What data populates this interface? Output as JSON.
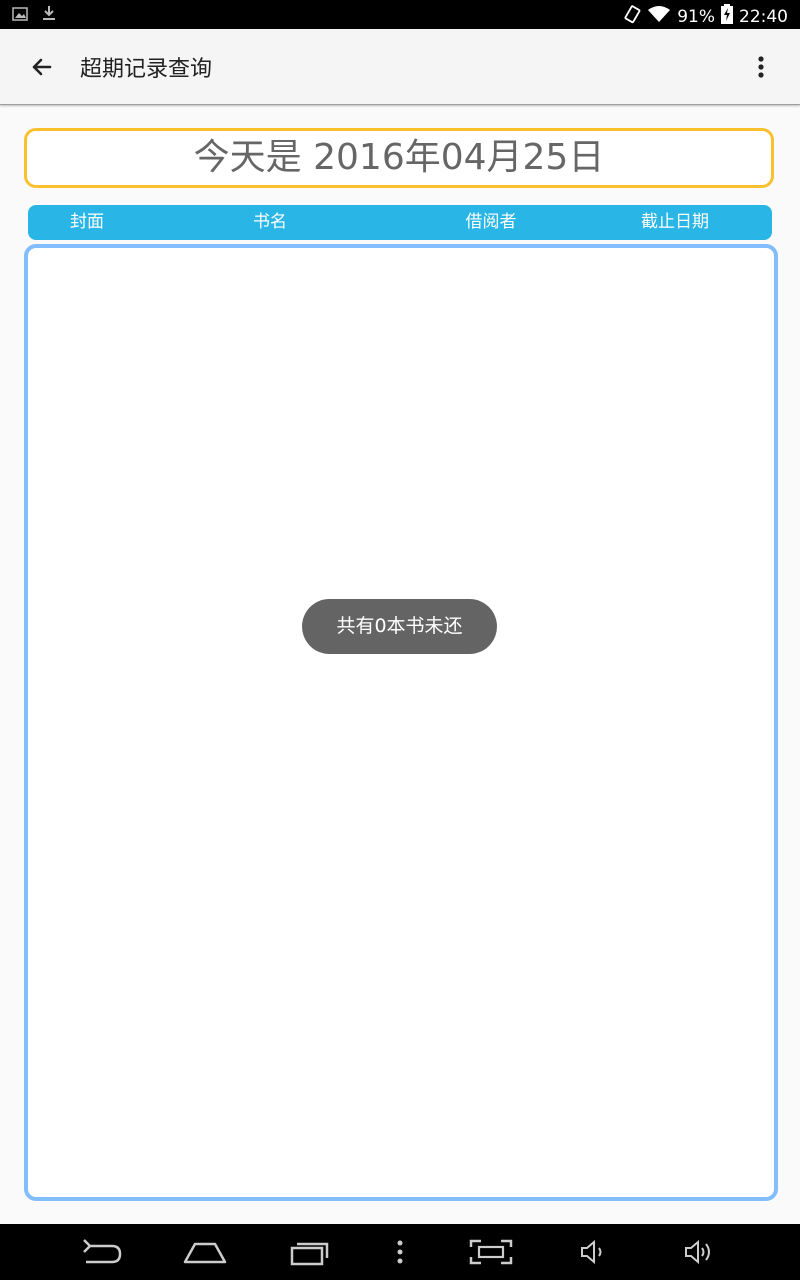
{
  "status_bar": {
    "battery": "91%",
    "time": "22:40",
    "icons": [
      "image-icon",
      "download-icon",
      "rotate-icon",
      "wifi-icon",
      "battery-charging-icon"
    ]
  },
  "app_bar": {
    "title": "超期记录查询",
    "back_icon": "arrow-back-icon",
    "menu_icon": "more-vert-icon"
  },
  "date_banner": {
    "text": "今天是 2016年04月25日",
    "border_color": "#fbc02d"
  },
  "table": {
    "header_color": "#29b6e6",
    "columns": [
      "封面",
      "书名",
      "借阅者",
      "截止日期"
    ],
    "rows": []
  },
  "toast": {
    "text": "共有0本书未还"
  },
  "nav_bar": {
    "icons": [
      "back-icon",
      "home-icon",
      "recents-icon",
      "menu-dots-icon",
      "screenshot-icon",
      "volume-down-icon",
      "volume-up-icon"
    ]
  }
}
